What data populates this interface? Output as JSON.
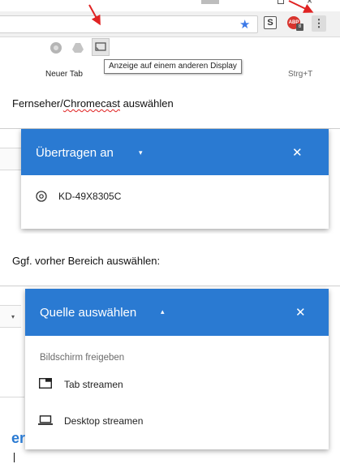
{
  "toolbar": {
    "window_close_glyph": "×",
    "star_glyph": "★",
    "extension_s_label": "S",
    "adblock_label": "ABP",
    "adblock_badge": "8",
    "menu_glyph": "⋮",
    "tooltip": "Anzeige auf einem anderen Display",
    "menu_item": "Neuer Tab",
    "menu_shortcut": "Strg+T",
    "icons": [
      "chrome-icon",
      "drive-icon",
      "cast-icon"
    ],
    "accent_color": "#3b78e7"
  },
  "captions": {
    "step1_prefix": "Fernseher/",
    "step1_underlined": "Chromecast",
    "step1_suffix": " auswählen",
    "step2": "Ggf. vorher Bereich auswählen:"
  },
  "cast_dialog": {
    "title": "Übertragen an",
    "caret": "▾",
    "close": "✕",
    "device": "KD-49X8305C",
    "header_color": "#2a7ad2"
  },
  "source_dialog": {
    "title": "Quelle auswählen",
    "caret": "▴",
    "close": "✕",
    "section_label": "Bildschirm freigeben",
    "options": [
      {
        "label": "Tab streamen",
        "icon": "tab-icon"
      },
      {
        "label": "Desktop streamen",
        "icon": "laptop-icon"
      }
    ],
    "header_color": "#2a7ad2"
  },
  "fragments": {
    "page_letters": "er"
  }
}
